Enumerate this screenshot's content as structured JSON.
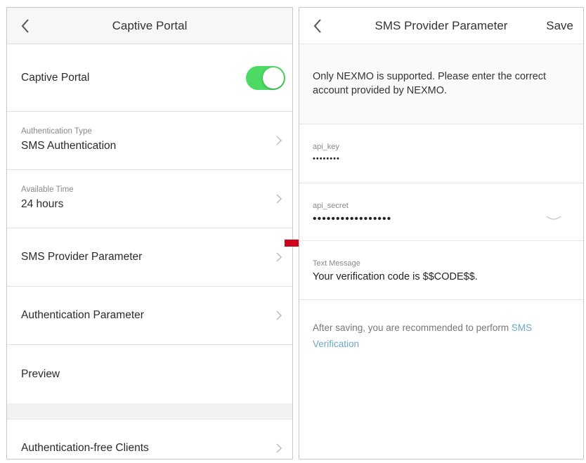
{
  "left": {
    "title": "Captive Portal",
    "toggle_row": {
      "label": "Captive Portal",
      "on": true
    },
    "auth_type": {
      "label": "Authentication Type",
      "value": "SMS Authentication"
    },
    "available_time": {
      "label": "Available Time",
      "value": "24 hours"
    },
    "sms_provider": "SMS Provider Parameter",
    "auth_param": "Authentication Parameter",
    "preview": "Preview",
    "auth_free": "Authentication-free Clients"
  },
  "right": {
    "title": "SMS Provider Parameter",
    "save": "Save",
    "notice": "Only NEXMO is supported. Please enter the correct account provided by NEXMO.",
    "api_key": {
      "label": "api_key",
      "value": "••••••••"
    },
    "api_secret": {
      "label": "api_secret",
      "value": "•••••••••••••••••"
    },
    "text_message": {
      "label": "Text Message",
      "value": "Your verification code is $$CODE$$."
    },
    "footer_text": "After saving, you are recommended to perform ",
    "footer_link": "SMS Verification"
  },
  "colors": {
    "toggle_on": "#4cd964",
    "link": "#6fa8c4",
    "arrow": "#d0021b"
  }
}
